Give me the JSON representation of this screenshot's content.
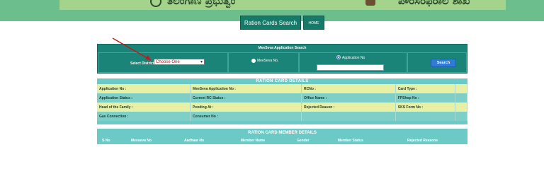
{
  "header": {
    "banner_left_text": "ತೆಲಂಗಾಣ ಪ್ರಭುತ್ವಂ",
    "banner_right_text": "ಪೌರಸರಫರಾಲ ಶಾಖ"
  },
  "nav": {
    "ration_search_label": "Ration Cards Search",
    "home_label": "HOME"
  },
  "search_form": {
    "title": "MeeSeva Application Search",
    "district_label": "Select District",
    "district_value": "Choose One",
    "meeseva_radio_label": "MeeSeva No.",
    "application_radio_label": "Application No",
    "search_button": "Search"
  },
  "details": {
    "title": "RATION CARD DETAILS",
    "rows": [
      [
        "Application No :",
        "MeeSeva Application No :",
        "RCNo :",
        "Card Type :"
      ],
      [
        "Application Status :",
        "Current RC Status :",
        "Office Name :",
        "FPShop No :"
      ],
      [
        "Head of the Family :",
        "Pending At :",
        "Rejected Reason :",
        "SKS Form No :"
      ],
      [
        "Gas Connection :",
        "Consumer No :",
        "",
        ""
      ]
    ]
  },
  "members": {
    "title": "RATION CARD MEMBER DETAILS",
    "columns": [
      "S No",
      "Meeseva No",
      "Aadhaar No",
      "Member Name",
      "Gender",
      "Member Status",
      "Rejected Reasons"
    ]
  },
  "colors": {
    "banner": "#6cbe8c",
    "panel_teal": "#1a8478",
    "details_teal": "#6bc9c6",
    "row_light": "#e7f0a4",
    "search_blue": "#2f7bd6"
  }
}
